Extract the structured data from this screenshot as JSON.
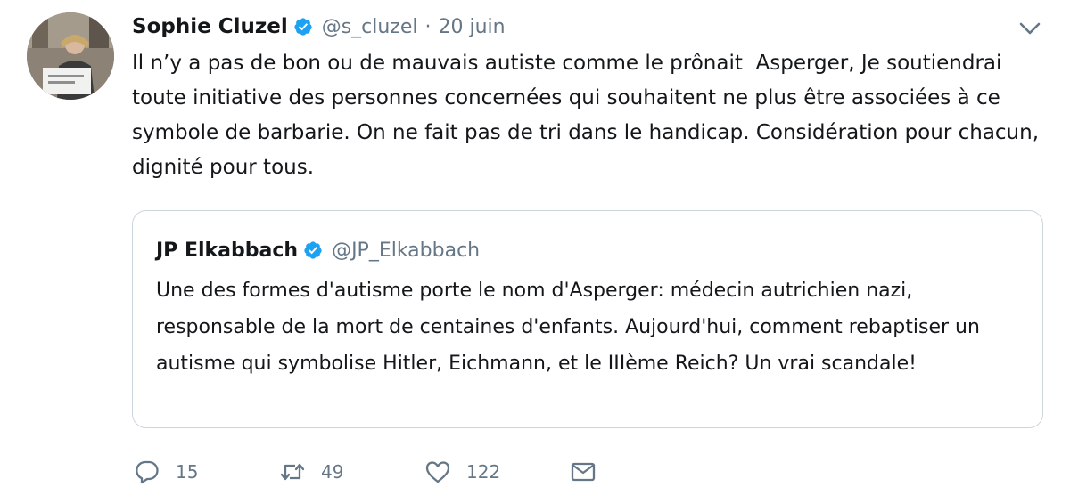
{
  "tweet": {
    "author_name": "Sophie Cluzel",
    "handle": "@s_cluzel",
    "separator": "·",
    "date": "20 juin",
    "text": "Il n’y a pas de bon ou de mauvais autiste comme le prônait  Asperger, Je soutiendrai toute initiative des personnes concernées qui souhaitent ne plus être associées à ce symbole de barbarie. On ne fait pas de tri dans le handicap. Considération pour chacun, dignité pour tous.",
    "avatar_icon": "user-photo-avatar",
    "verified_icon": "verified-badge-icon",
    "caret_icon": "chevron-down-icon"
  },
  "quoted_tweet": {
    "author_name": "JP Elkabbach",
    "handle": "@JP_Elkabbach",
    "text": "Une des formes d'autisme porte le nom d'Asperger: médecin autrichien nazi, responsable de la mort de centaines d'enfants. Aujourd'hui, comment rebaptiser un autisme qui symbolise Hitler, Eichmann, et le IIIème Reich? Un vrai scandale!"
  },
  "actions": {
    "reply_count": "15",
    "retweet_count": "49",
    "like_count": "122",
    "reply_icon": "reply-icon",
    "retweet_icon": "retweet-icon",
    "like_icon": "heart-icon",
    "dm_icon": "envelope-icon"
  },
  "colors": {
    "verified": "#1da1f2",
    "text": "#14171a",
    "secondary": "#657786",
    "border": "#ccd6dd"
  }
}
